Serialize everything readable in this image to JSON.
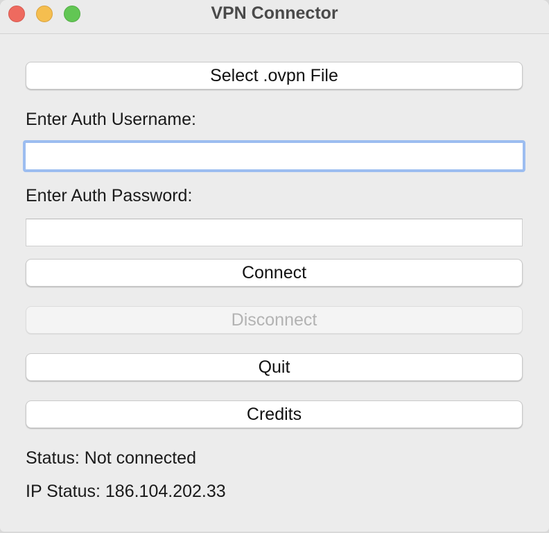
{
  "window": {
    "title": "VPN Connector"
  },
  "buttons": {
    "select_file": "Select .ovpn File",
    "connect": "Connect",
    "disconnect": "Disconnect",
    "quit": "Quit",
    "credits": "Credits"
  },
  "fields": {
    "username_label": "Enter Auth Username:",
    "username_value": "",
    "password_label": "Enter Auth Password:",
    "password_value": ""
  },
  "status": {
    "connection": "Status: Not connected",
    "ip": "IP Status: 186.104.202.33"
  },
  "colors": {
    "close": "#ee6a5f",
    "minimize": "#f5be4f",
    "maximize": "#62c654",
    "focus_ring": "#9cbdf0"
  }
}
